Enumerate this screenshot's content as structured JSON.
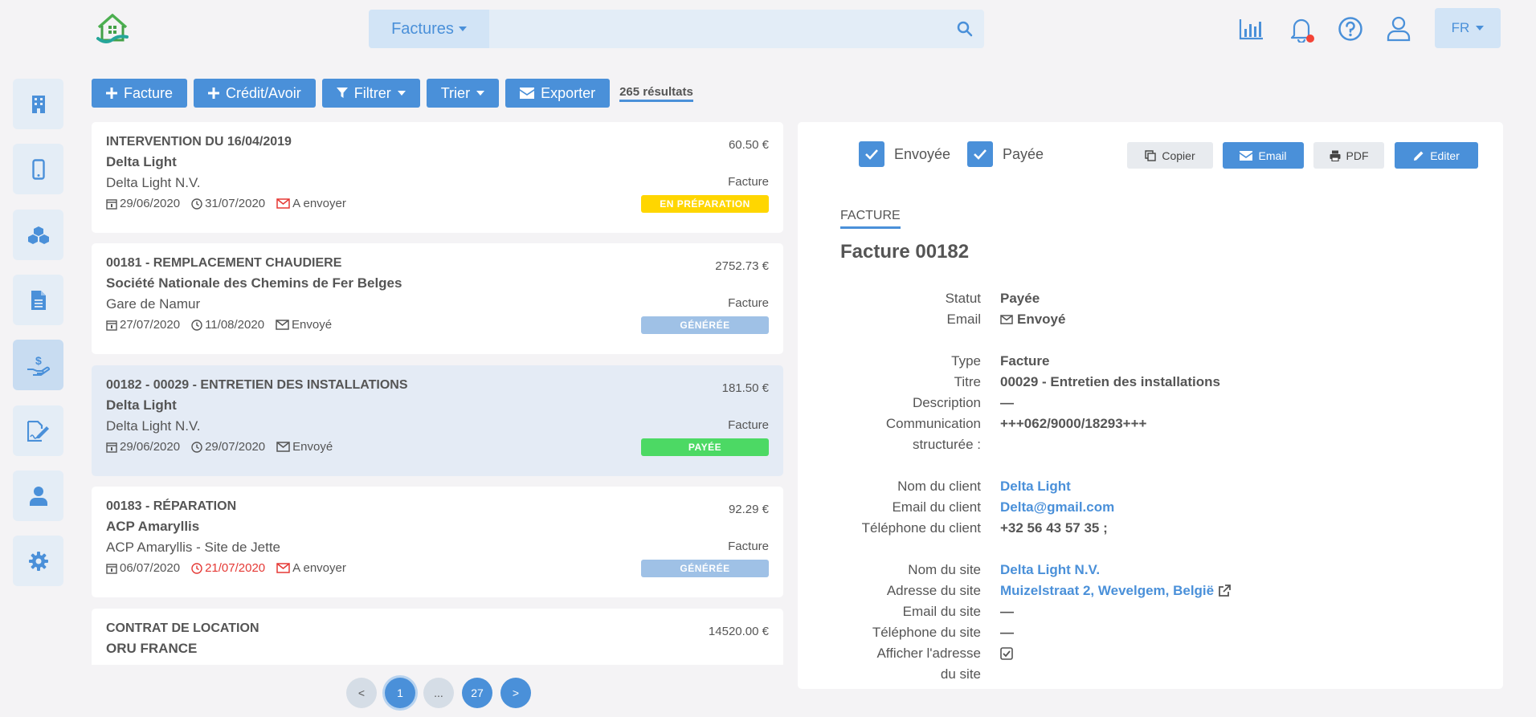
{
  "header": {
    "search_dropdown": "Factures",
    "search_placeholder": "",
    "language": "FR"
  },
  "toolbar": {
    "new_invoice": "Facture",
    "new_credit": "Crédit/Avoir",
    "filter": "Filtrer",
    "sort": "Trier",
    "export": "Exporter",
    "results": "265 résultats"
  },
  "cards": [
    {
      "title": "INTERVENTION DU 16/04/2019",
      "client": "Delta Light",
      "site": "Delta Light N.V.",
      "date": "29/06/2020",
      "due": "31/07/2020",
      "mail": "A envoyer",
      "amount": "60.50 €",
      "type": "Facture",
      "badge": "EN PRÉPARATION"
    },
    {
      "title": "00181 - REMPLACEMENT CHAUDIERE",
      "client": "Société Nationale des Chemins de Fer Belges",
      "site": "Gare de Namur",
      "date": "27/07/2020",
      "due": "11/08/2020",
      "mail": "Envoyé",
      "amount": "2752.73 €",
      "type": "Facture",
      "badge": "GÉNÉRÉE"
    },
    {
      "title": "00182 - 00029 - ENTRETIEN DES INSTALLATIONS",
      "client": "Delta Light",
      "site": "Delta Light N.V.",
      "date": "29/06/2020",
      "due": "29/07/2020",
      "mail": "Envoyé",
      "amount": "181.50 €",
      "type": "Facture",
      "badge": "PAYÉE"
    },
    {
      "title": "00183 - RÉPARATION",
      "client": "ACP Amaryllis",
      "site": "ACP Amaryllis - Site de Jette",
      "date": "06/07/2020",
      "due": "21/07/2020",
      "mail": "A envoyer",
      "amount": "92.29 €",
      "type": "Facture",
      "badge": "GÉNÉRÉE"
    },
    {
      "title": "CONTRAT DE LOCATION",
      "client": "ORU FRANCE",
      "amount": "14520.00 €"
    }
  ],
  "colors": {
    "accent": "#4a90d9",
    "badge_preparation": "#ffd600",
    "badge_generated": "#9fc1e6",
    "badge_paid": "#4cd964",
    "overdue": "#e53935",
    "notification_dot": "#f44336"
  },
  "pagination": {
    "prev": "<",
    "current": "1",
    "ellipsis": "...",
    "last": "27",
    "next": ">"
  },
  "detail": {
    "sent_label": "Envoyée",
    "paid_label": "Payée",
    "copy": "Copier",
    "email": "Email",
    "pdf": "PDF",
    "edit": "Editer",
    "section": "FACTURE",
    "title": "Facture 00182",
    "status_label": "Statut",
    "status": "Payée",
    "email_label": "Email",
    "email_value": "Envoyé",
    "type_label": "Type",
    "type": "Facture",
    "titre_label": "Titre",
    "titre": "00029 - Entretien des installations",
    "description_label": "Description",
    "description": "—",
    "communication_label": "Communication",
    "communication_label2": "structurée :",
    "communication": "+++062/9000/18293+++",
    "client_name_label": "Nom du client",
    "client_name": "Delta Light",
    "client_email_label": "Email du client",
    "client_email": "Delta@gmail.com",
    "client_phone_label": "Téléphone du client",
    "client_phone": "+32 56 43 57 35 ;",
    "site_name_label": "Nom du site",
    "site_name": "Delta Light N.V.",
    "site_address_label": "Adresse du site",
    "site_address": "Muizelstraat 2, Wevelgem, België",
    "site_email_label": "Email du site",
    "site_email": "—",
    "site_phone_label": "Téléphone du site",
    "site_phone": "—",
    "show_address_label": "Afficher l'adresse",
    "show_address_label2": "du site"
  }
}
